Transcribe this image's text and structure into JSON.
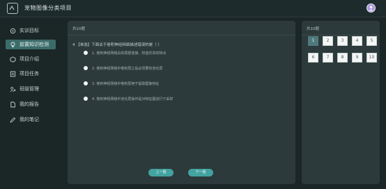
{
  "app": {
    "title": "宠物图像分类项目"
  },
  "sidebar": {
    "items": [
      {
        "label": "实训目标",
        "icon": "target-icon"
      },
      {
        "label": "前置知识检测",
        "icon": "lightbulb-icon",
        "active": true
      },
      {
        "label": "项目介绍",
        "icon": "cube-icon"
      },
      {
        "label": "项目任务",
        "icon": "task-icon"
      },
      {
        "label": "班级管理",
        "icon": "people-icon"
      },
      {
        "label": "我的报告",
        "icon": "document-icon"
      },
      {
        "label": "我的笔记",
        "icon": "pen-icon"
      }
    ]
  },
  "main": {
    "header": "共10题",
    "question": "4 【单选】下面关于卷积神经网络描述错误的是（ ）",
    "options": [
      "1. 卷积神经网络具有局部连接、权值共享的特点",
      "2. 卷积神经网络中卷积层之后必须要有池化层",
      "3. 卷积神经网络中卷积层用于提取图像特征",
      "4. 卷积神经网络中池化层操作是对特征图进行下采样"
    ],
    "prev_label": "上一题",
    "next_label": "下一题"
  },
  "side": {
    "header": "共10题",
    "numbers": [
      "1",
      "2",
      "3",
      "4",
      "5",
      "6",
      "7",
      "8",
      "9",
      "10"
    ],
    "current": "1"
  },
  "colors": {
    "accent": "#43a3a0",
    "active_nav": "#3b6c6a",
    "panel": "#2c3a3b",
    "background": "#1b2627"
  }
}
